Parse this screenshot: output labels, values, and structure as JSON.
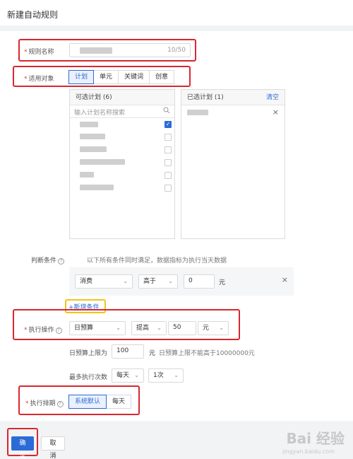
{
  "page": {
    "title": "新建自动规则"
  },
  "rule_name": {
    "label": "规则名称",
    "counter": "10/50"
  },
  "target": {
    "label": "适用对象",
    "tabs": [
      "计划",
      "单元",
      "关键词",
      "创意"
    ],
    "active_tab": 0
  },
  "available": {
    "header": "可选计划 (6)",
    "search_placeholder": "输入计划名称搜索",
    "items": [
      {
        "checked": true
      },
      {
        "checked": false
      },
      {
        "checked": false
      },
      {
        "checked": false
      },
      {
        "checked": false
      },
      {
        "checked": false
      }
    ]
  },
  "selected": {
    "header": "已选计划 (1)",
    "clear_label": "清空",
    "remove_glyph": "×"
  },
  "condition": {
    "label": "判断条件",
    "hint": "以下所有条件同时满足，数据指标为执行当天数据",
    "metric": "消费",
    "operator": "高于",
    "value": "0",
    "unit": "元",
    "remove_glyph": "×",
    "add_label": "+新增条件"
  },
  "action": {
    "label": "执行操作",
    "target": "日预算",
    "op": "提高",
    "value": "50",
    "unit": "元",
    "limit_label": "日预算上限为",
    "limit_value": "100",
    "limit_unit": "元",
    "limit_hint": "日预算上限不能高于10000000元",
    "freq_label": "最多执行次数",
    "freq_period": "每天",
    "freq_count": "1次"
  },
  "schedule": {
    "label": "执行排期",
    "options": [
      "系统默认",
      "每天"
    ],
    "active": 0
  },
  "footer": {
    "confirm": "确定",
    "cancel": "取消"
  },
  "watermark": {
    "text": "Bai 经验",
    "sub": "jingyan.baidu.com"
  },
  "colors": {
    "accent": "#2b6bd6",
    "highlight_red": "#d9272e",
    "highlight_yellow": "#f0c419"
  }
}
